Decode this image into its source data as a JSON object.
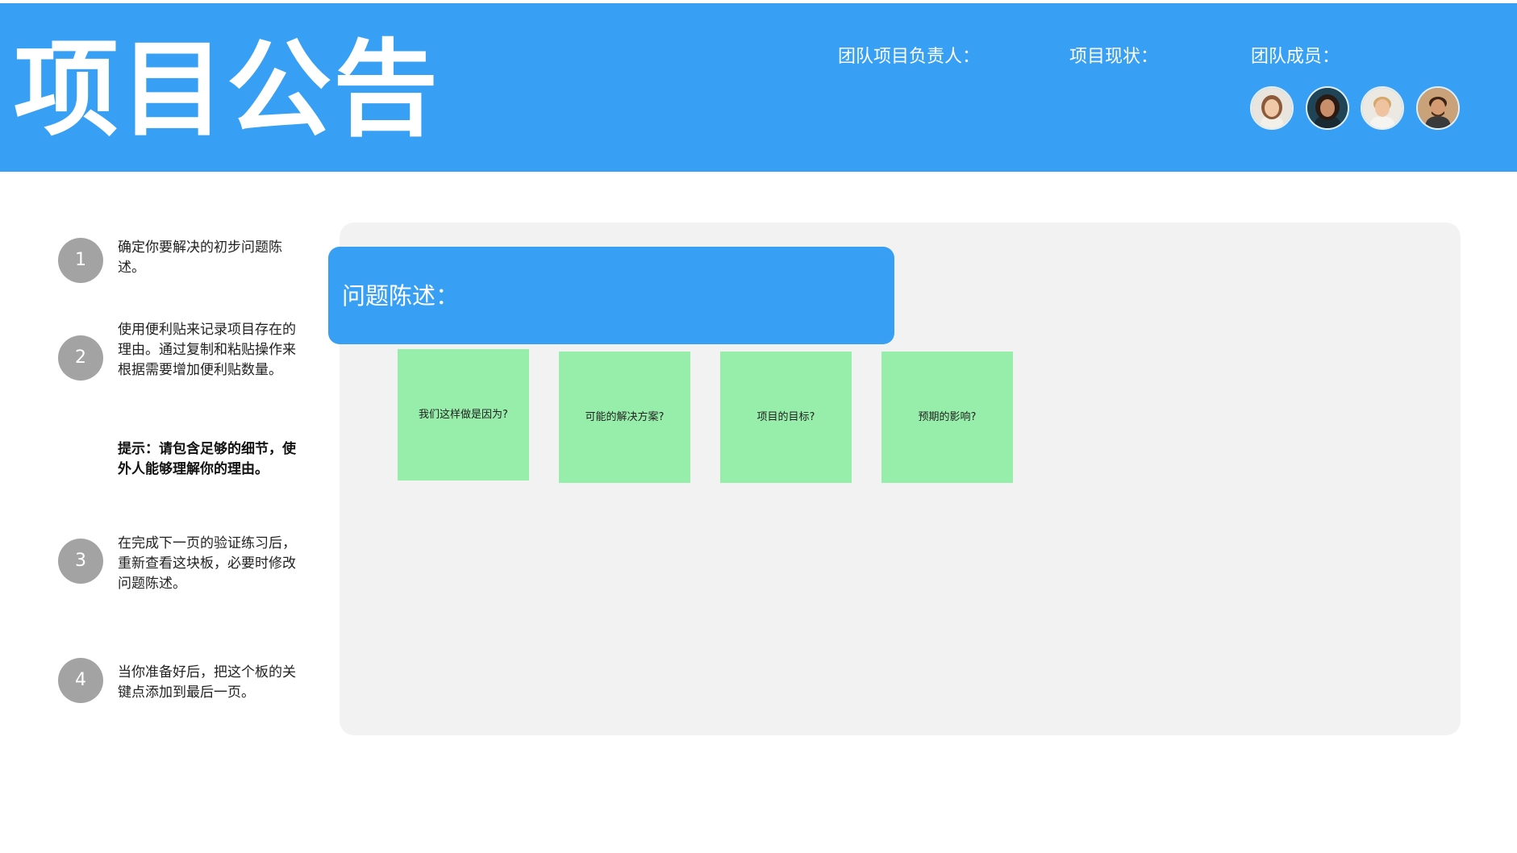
{
  "header": {
    "title": "项目公告",
    "lead_label": "团队项目负责人：",
    "status_label": "项目现状：",
    "members_label": "团队成员：",
    "accent_color": "#37a0f4"
  },
  "steps": [
    {
      "number": "1",
      "text": "确定你要解决的初步问题陈述。"
    },
    {
      "number": "2",
      "text": "使用便利贴来记录项目存在的理由。通过复制和粘贴操作来根据需要增加便利贴数量。"
    },
    {
      "number": "3",
      "text": "在完成下一页的验证练习后，重新查看这块板，必要时修改问题陈述。"
    },
    {
      "number": "4",
      "text": "当你准备好后，把这个板的关键点添加到最后一页。"
    }
  ],
  "tip": "提示：请包含足够的细节，使外人能够理解你的理由。",
  "board": {
    "problem_label": "问题陈述：",
    "stickies": [
      {
        "text": "我们这样做是因为?"
      },
      {
        "text": "可能的解决方案?"
      },
      {
        "text": "项目的目标?"
      },
      {
        "text": "预期的影响?"
      }
    ],
    "sticky_color": "#97eeaa"
  }
}
